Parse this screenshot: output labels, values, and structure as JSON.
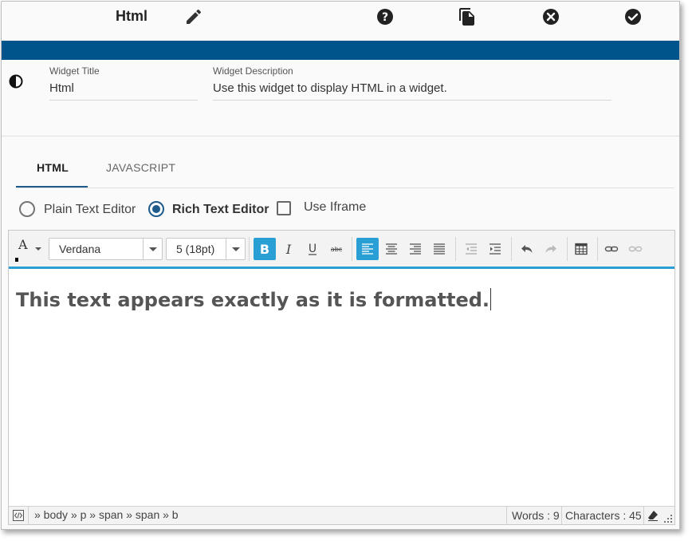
{
  "header": {
    "title": "Html",
    "icons": [
      "edit-icon",
      "help-icon",
      "copy-icon",
      "cancel-icon",
      "confirm-icon"
    ]
  },
  "colors": {
    "brand_bar": "#00548c",
    "tab_underline": "#1e5a8a",
    "toolbar_active": "#2a9fd6"
  },
  "settings": {
    "title_label": "Widget Title",
    "title_value": "Html",
    "description_label": "Widget Description",
    "description_value": "Use this widget to display HTML in a widget."
  },
  "tabs": [
    {
      "label": "HTML",
      "active": true
    },
    {
      "label": "JAVASCRIPT",
      "active": false
    }
  ],
  "editor_mode": {
    "plain_label": "Plain Text Editor",
    "rich_label": "Rich Text Editor",
    "iframe_label": "Use Iframe",
    "selected": "rich",
    "use_iframe": false
  },
  "toolbar": {
    "font_color_glyph": "A",
    "font_name": "Verdana",
    "font_size": "5 (18pt)"
  },
  "content": {
    "text": "This text appears exactly as it is formatted."
  },
  "statusbar": {
    "path": "» body » p » span » span » b",
    "words": "Words : 9",
    "characters": "Characters : 45"
  }
}
